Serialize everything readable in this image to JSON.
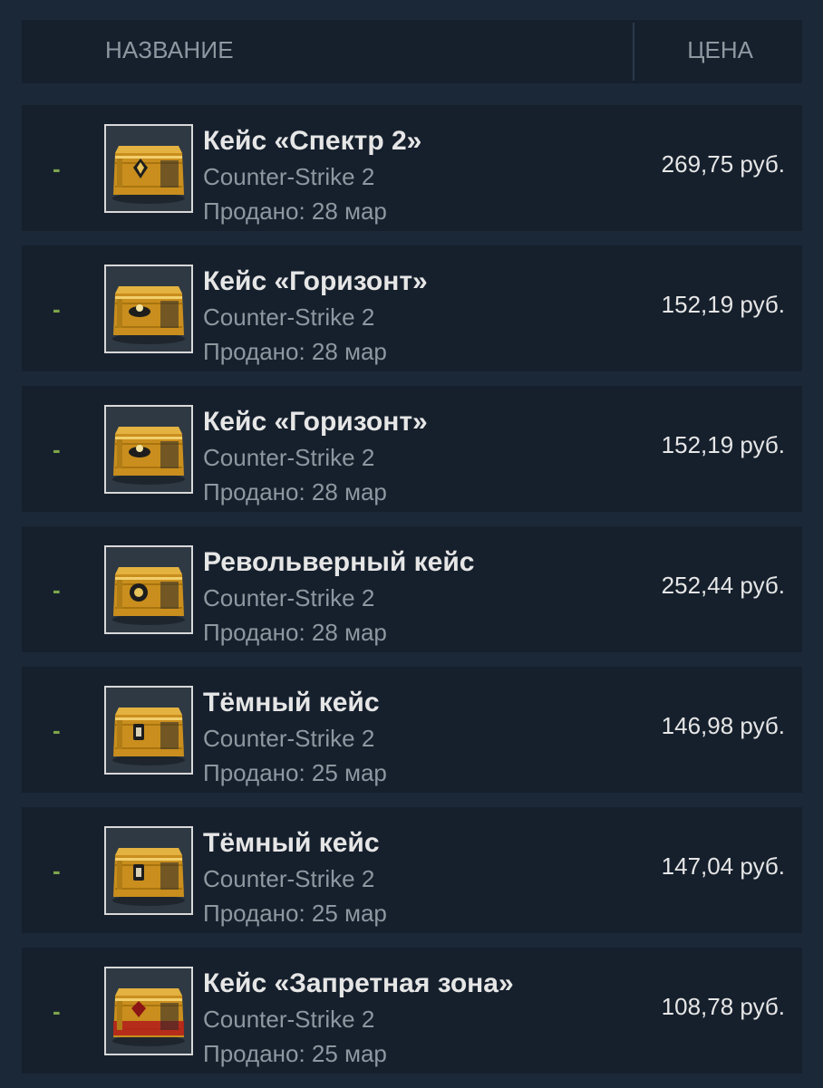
{
  "header": {
    "name_label": "НАЗВАНИЕ",
    "price_label": "ЦЕНА"
  },
  "colors": {
    "background": "#1b2838",
    "row_background": "#16202d",
    "dash": "#7ea64b",
    "case_gold": "#d9a22a"
  },
  "items": [
    {
      "status": "-",
      "name": "Кейс «Спектр 2»",
      "game": "Counter-Strike 2",
      "sold": "Продано: 28 мар",
      "price": "269,75 руб.",
      "icon": "spectrum-2-case-icon"
    },
    {
      "status": "-",
      "name": "Кейс «Горизонт»",
      "game": "Counter-Strike 2",
      "sold": "Продано: 28 мар",
      "price": "152,19 руб.",
      "icon": "horizon-case-icon"
    },
    {
      "status": "-",
      "name": "Кейс «Горизонт»",
      "game": "Counter-Strike 2",
      "sold": "Продано: 28 мар",
      "price": "152,19 руб.",
      "icon": "horizon-case-icon"
    },
    {
      "status": "-",
      "name": "Револьверный кейс",
      "game": "Counter-Strike 2",
      "sold": "Продано: 28 мар",
      "price": "252,44 руб.",
      "icon": "revolver-case-icon"
    },
    {
      "status": "-",
      "name": "Тёмный кейс",
      "game": "Counter-Strike 2",
      "sold": "Продано: 25 мар",
      "price": "146,98 руб.",
      "icon": "shadow-case-icon"
    },
    {
      "status": "-",
      "name": "Тёмный кейс",
      "game": "Counter-Strike 2",
      "sold": "Продано: 25 мар",
      "price": "147,04 руб.",
      "icon": "shadow-case-icon"
    },
    {
      "status": "-",
      "name": "Кейс «Запретная зона»",
      "game": "Counter-Strike 2",
      "sold": "Продано: 25 мар",
      "price": "108,78 руб.",
      "icon": "danger-zone-case-icon"
    }
  ]
}
